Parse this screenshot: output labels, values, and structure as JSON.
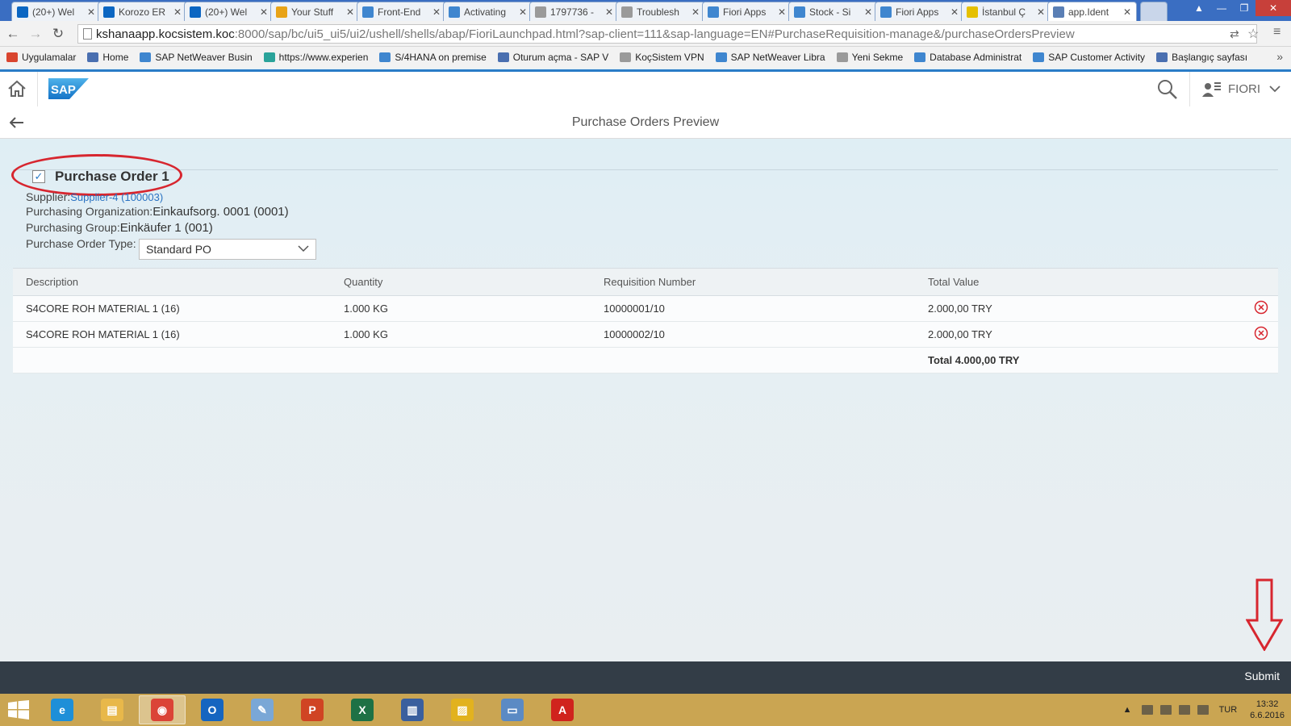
{
  "browser": {
    "tabs": [
      {
        "label": "(20+) Wel",
        "icon": "linkedin-icon",
        "color": "#0b66c2"
      },
      {
        "label": "Korozo ER",
        "icon": "linkedin-icon",
        "color": "#0b66c2"
      },
      {
        "label": "(20+) Wel",
        "icon": "linkedin-icon",
        "color": "#0b66c2"
      },
      {
        "label": "Your Stuff",
        "icon": "scn-icon",
        "color": "#e8a317"
      },
      {
        "label": "Front-End",
        "icon": "sap-icon",
        "color": "#3f86cf"
      },
      {
        "label": "Activating",
        "icon": "sap-icon",
        "color": "#3f86cf"
      },
      {
        "label": "1797736 -",
        "icon": "page-icon",
        "color": "#9a9a9a"
      },
      {
        "label": "Troublesh",
        "icon": "page-icon",
        "color": "#9a9a9a"
      },
      {
        "label": "Fiori Apps",
        "icon": "sap-icon",
        "color": "#3f86cf"
      },
      {
        "label": "Stock - Si",
        "icon": "sap-icon",
        "color": "#3f86cf"
      },
      {
        "label": "Fiori Apps",
        "icon": "sap-icon",
        "color": "#3f86cf"
      },
      {
        "label": "İstanbul Ç",
        "icon": "s-icon",
        "color": "#e5c000"
      },
      {
        "label": "app.Ident",
        "icon": "app-icon",
        "color": "#5a7fb5"
      }
    ],
    "url_host": "kshanaapp.kocsistem.koc",
    "url_rest": ":8000/sap/bc/ui5_ui5/ui2/ushell/shells/abap/FioriLaunchpad.html?sap-client=111&sap-language=EN#PurchaseRequisition-manage&/purchaseOrdersPreview",
    "bookmarks": [
      {
        "label": "Uygulamalar",
        "color": "#d9452f"
      },
      {
        "label": "Home",
        "color": "#4a6fb0"
      },
      {
        "label": "SAP NetWeaver Busin",
        "color": "#3f86cf"
      },
      {
        "label": "https://www.experien",
        "color": "#2aa39a"
      },
      {
        "label": "S/4HANA on premise",
        "color": "#3f86cf"
      },
      {
        "label": "Oturum açma - SAP V",
        "color": "#4a6fb0"
      },
      {
        "label": "KoçSistem VPN",
        "color": "#9a9a9a"
      },
      {
        "label": "SAP NetWeaver Libra",
        "color": "#3f86cf"
      },
      {
        "label": "Yeni Sekme",
        "color": "#9a9a9a"
      },
      {
        "label": "Database Administrat",
        "color": "#3f86cf"
      },
      {
        "label": "SAP Customer Activity",
        "color": "#3f86cf"
      },
      {
        "label": "Başlangıç sayfası",
        "color": "#4a6fb0"
      }
    ]
  },
  "shell": {
    "logo_text": "SAP",
    "user": "FIORI"
  },
  "page": {
    "title": "Purchase Orders Preview"
  },
  "po": {
    "title": "Purchase Order 1",
    "supplier_label": "Supplier:",
    "supplier_value": "Supplier-4 (100003)",
    "org_label": "Purchasing Organization:",
    "org_value": "Einkaufsorg. 0001 (0001)",
    "group_label": "Purchasing Group:",
    "group_value": "Einkäufer 1 (001)",
    "type_label": "Purchase Order Type:",
    "type_value": "Standard PO"
  },
  "table": {
    "columns": [
      "Description",
      "Quantity",
      "Requisition Number",
      "Total Value"
    ],
    "rows": [
      {
        "description": "S4CORE ROH MATERIAL 1 (16)",
        "quantity": "1.000 KG",
        "requisition": "10000001/10",
        "total": "2.000,00 TRY"
      },
      {
        "description": "S4CORE ROH MATERIAL 1 (16)",
        "quantity": "1.000 KG",
        "requisition": "10000002/10",
        "total": "2.000,00 TRY"
      }
    ],
    "total_label": "Total 4.000,00 TRY"
  },
  "footer": {
    "submit_label": "Submit"
  },
  "taskbar": {
    "apps": [
      {
        "name": "ie-icon",
        "color": "#1e8fd8",
        "glyph": "e"
      },
      {
        "name": "file-explorer-icon",
        "color": "#e8b84a",
        "glyph": "▤"
      },
      {
        "name": "chrome-icon",
        "color": "#db4437",
        "glyph": "◉"
      },
      {
        "name": "outlook-icon",
        "color": "#1565c0",
        "glyph": "O"
      },
      {
        "name": "paint-icon",
        "color": "#7aa7d6",
        "glyph": "✎"
      },
      {
        "name": "powerpoint-icon",
        "color": "#d04423",
        "glyph": "P"
      },
      {
        "name": "excel-icon",
        "color": "#1e7145",
        "glyph": "X"
      },
      {
        "name": "sap-logon-icon",
        "color": "#3a5f9e",
        "glyph": "▥"
      },
      {
        "name": "sticky-icon",
        "color": "#e2b21e",
        "glyph": "▨"
      },
      {
        "name": "remote-desktop-icon",
        "color": "#5b8ac4",
        "glyph": "▭"
      },
      {
        "name": "acrobat-icon",
        "color": "#d0231d",
        "glyph": "A"
      }
    ],
    "lang": "TUR",
    "time": "13:32",
    "date": "6.6.2016"
  }
}
